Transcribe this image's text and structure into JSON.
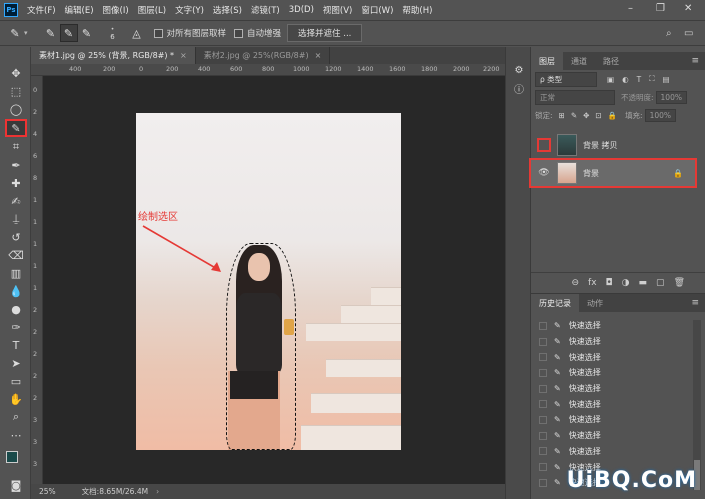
{
  "menubar": {
    "logo": "Ps",
    "items": [
      "文件(F)",
      "编辑(E)",
      "图像(I)",
      "图层(L)",
      "文字(Y)",
      "选择(S)",
      "滤镜(T)",
      "3D(D)",
      "视图(V)",
      "窗口(W)",
      "帮助(H)"
    ],
    "window_controls": [
      "–",
      "❐",
      "✕"
    ]
  },
  "options": {
    "brush_size": "6",
    "sample_all_layers": "对所有图层取样",
    "auto_enhance": "自动增强",
    "select_mask": "选择并遮住 ..."
  },
  "tabs": [
    {
      "label": "素材1.jpg @ 25% (背景, RGB/8#) *",
      "close": "×"
    },
    {
      "label": "素材2.jpg @ 25%(RGB/8#)",
      "close": "×"
    }
  ],
  "ruler": {
    "top_labels": [
      "400",
      "200",
      "0",
      "200",
      "400",
      "600",
      "800",
      "1000",
      "1200",
      "1400",
      "1600",
      "1800",
      "2000",
      "2200"
    ],
    "left_labels": [
      "0",
      "2",
      "4",
      "6",
      "8",
      "1",
      "1",
      "1",
      "1",
      "1",
      "2",
      "2",
      "2",
      "2",
      "2",
      "3",
      "3",
      "3"
    ]
  },
  "canvas": {
    "annotation": "绘制选区"
  },
  "status": {
    "zoom": "25%",
    "doc": "文档:8.65M/26.4M",
    "arrow": "›"
  },
  "layers_panel": {
    "tabs": [
      "图层",
      "通道",
      "路径"
    ],
    "menu": "≡",
    "filter_kind": "ρ 类型",
    "filter_icons": [
      "▣",
      "◐",
      "T",
      "⛶",
      "▤"
    ],
    "blend_mode": "正常",
    "opacity_label": "不透明度:",
    "opacity_value": "100%",
    "lock_label": "锁定:",
    "fill_label": "填充:",
    "fill_value": "100%",
    "lock_icons": [
      "⊞",
      "✎",
      "✥",
      "⊡",
      "🔒"
    ],
    "layers": [
      {
        "name": "背景 拷贝",
        "visible": false
      },
      {
        "name": "背景",
        "visible": true,
        "lock": "🔒"
      }
    ],
    "footer_icons": [
      "⊖",
      "fx",
      "◘",
      "◑",
      "▬",
      "▢",
      "🗑"
    ]
  },
  "history_panel": {
    "tabs": [
      "历史记录",
      "动作"
    ],
    "menu": "≡",
    "entries": [
      "快速选择",
      "快速选择",
      "快速选择",
      "快速选择",
      "快速选择",
      "快速选择",
      "快速选择",
      "快速选择",
      "快速选择",
      "快速选择",
      "快速选择"
    ]
  },
  "watermark": "UiBQ.CoM",
  "colors": {
    "selection_highlight": "#e53935",
    "panel_bg": "#535353",
    "canvas_bg": "#282828"
  }
}
